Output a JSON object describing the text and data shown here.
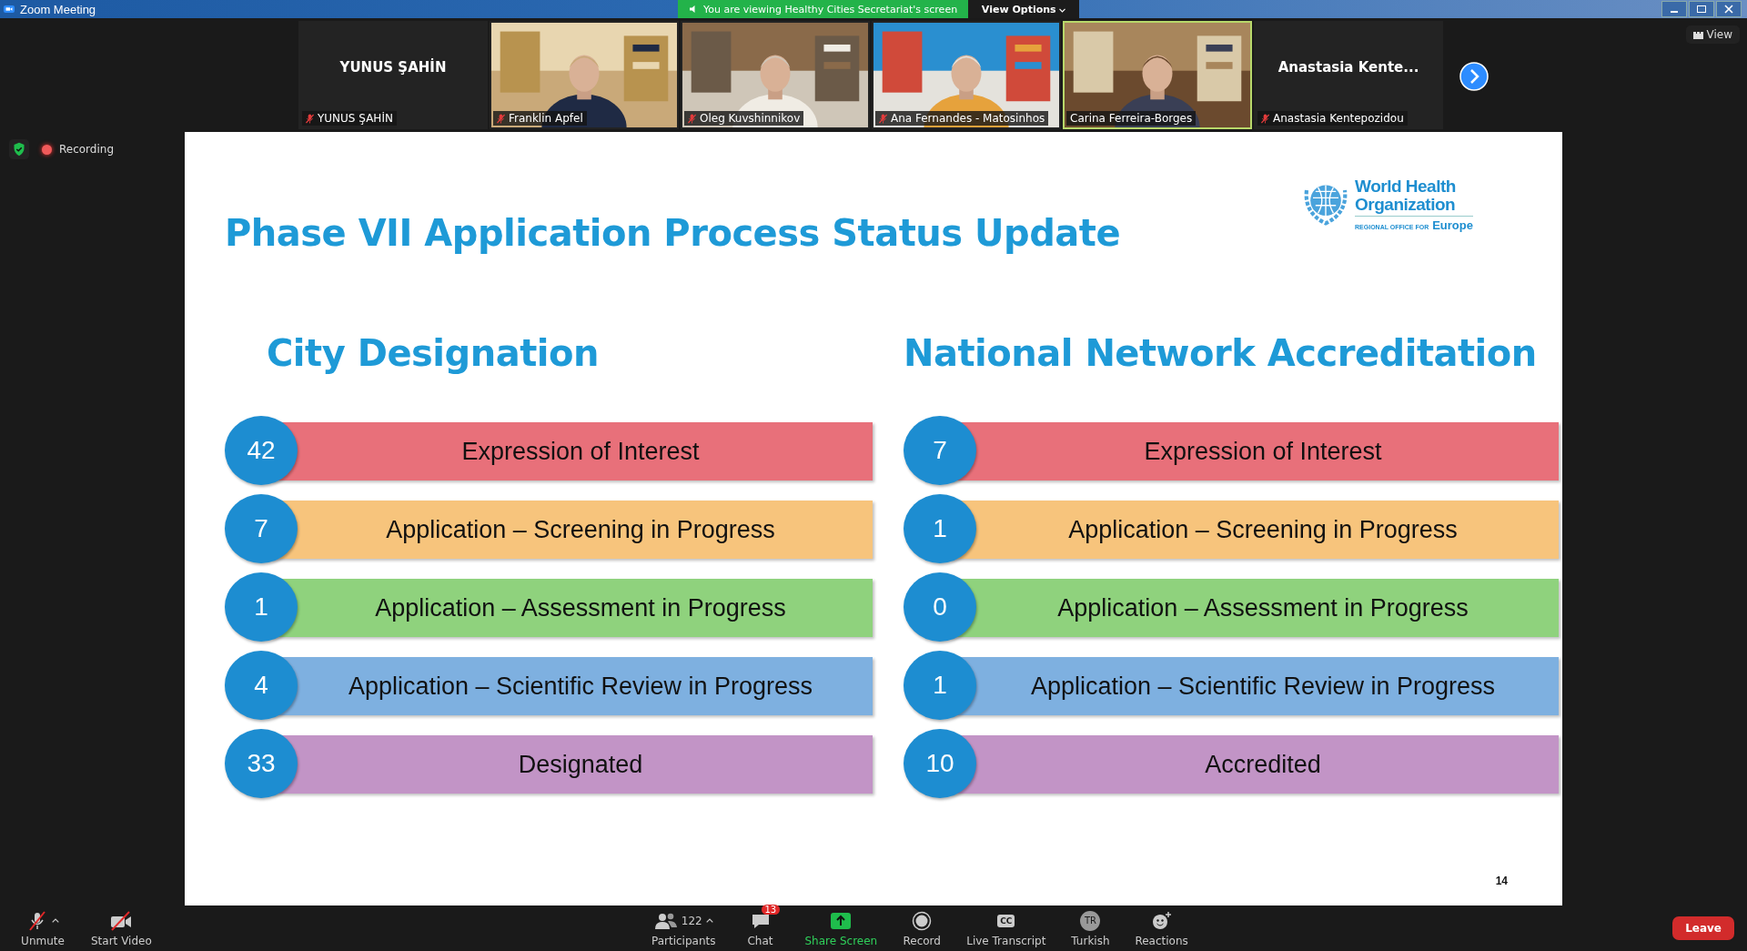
{
  "title_bar": {
    "title": "Zoom Meeting",
    "banner": "You are viewing Healthy Cities Secretariat's screen",
    "view_options": "View Options"
  },
  "participants": [
    {
      "kind": "name",
      "label": "YUNUS ŞAHİN",
      "name": "YUNUS ŞAHİN",
      "muted": true,
      "active": false
    },
    {
      "kind": "video",
      "name": "Franklin Apfel",
      "muted": true,
      "active": false
    },
    {
      "kind": "video",
      "name": "Oleg Kuvshinnikov",
      "muted": true,
      "active": false
    },
    {
      "kind": "video",
      "name": "Ana Fernandes - Matosinhos",
      "muted": true,
      "active": false
    },
    {
      "kind": "video",
      "name": "Carina Ferreira-Borges",
      "muted": false,
      "active": true
    },
    {
      "kind": "name",
      "label": "Anastasia Kente...",
      "name": "Anastasia Kentepozidou",
      "muted": true,
      "active": false
    }
  ],
  "view_button": "View",
  "recording": "Recording",
  "slide": {
    "title": "Phase VII Application Process Status Update",
    "logo": {
      "line1": "World Health",
      "line2": "Organization",
      "sub": "REGIONAL OFFICE FOR",
      "region": "Europe"
    },
    "columns": [
      {
        "heading": "City Designation",
        "rows": [
          {
            "count": "42",
            "label": "Expression of Interest",
            "color": "#e8707a"
          },
          {
            "count": "7",
            "label": "Application –  Screening in Progress",
            "color": "#f7c47c"
          },
          {
            "count": "1",
            "label": "Application – Assessment in Progress",
            "color": "#8fd27d"
          },
          {
            "count": "4",
            "label": "Application – Scientific Review in Progress",
            "color": "#7eb0e0"
          },
          {
            "count": "33",
            "label": "Designated",
            "color": "#c294c6"
          }
        ]
      },
      {
        "heading": "National Network Accreditation",
        "rows": [
          {
            "count": "7",
            "label": "Expression of Interest",
            "color": "#e8707a"
          },
          {
            "count": "1",
            "label": "Application –  Screening in Progress",
            "color": "#f7c47c"
          },
          {
            "count": "0",
            "label": "Application – Assessment in Progress",
            "color": "#8fd27d"
          },
          {
            "count": "1",
            "label": "Application – Scientific Review in Progress",
            "color": "#7eb0e0"
          },
          {
            "count": "10",
            "label": "Accredited",
            "color": "#c294c6"
          }
        ]
      }
    ],
    "page": "14"
  },
  "toolbar": {
    "left": [
      {
        "kind": "mic",
        "label": "Unmute",
        "caret": true
      },
      {
        "kind": "video",
        "label": "Start Video",
        "caret": false
      }
    ],
    "center": [
      {
        "kind": "participants",
        "label": "Participants",
        "count": "122",
        "caret": true
      },
      {
        "kind": "chat",
        "label": "Chat",
        "badge": "13"
      },
      {
        "kind": "share",
        "label": "Share Screen"
      },
      {
        "kind": "record",
        "label": "Record"
      },
      {
        "kind": "cc",
        "label": "Live Transcript",
        "glyph": "CC"
      },
      {
        "kind": "lang",
        "label": "Turkish",
        "glyph": "TR"
      },
      {
        "kind": "reactions",
        "label": "Reactions"
      }
    ],
    "leave": "Leave"
  }
}
